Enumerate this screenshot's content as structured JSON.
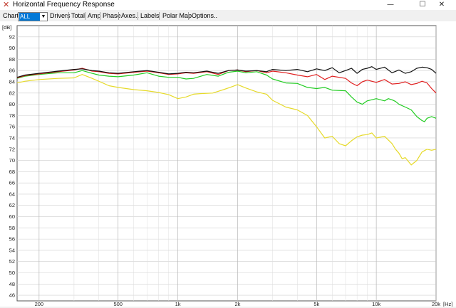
{
  "window": {
    "title": "Horizontal Frequency Response",
    "app_icon": "x-cross-icon",
    "minimize_glyph": "—",
    "maximize_glyph": "☐",
    "close_glyph": "✕"
  },
  "toolbar": {
    "chart_label": "Chart",
    "chart_value": "ALL",
    "buttons": [
      "Drivers",
      "Total",
      "Amp",
      "Phase",
      "Axes..",
      "Labels",
      "Polar Map",
      "Options.."
    ]
  },
  "chart_data": {
    "type": "line",
    "ylabel": "[dB]",
    "xlabel": "[Hz]",
    "xscale": "log",
    "xlim": [
      155,
      20000
    ],
    "ylim": [
      45,
      94
    ],
    "yticks": [
      46,
      48,
      50,
      52,
      54,
      56,
      58,
      60,
      62,
      64,
      66,
      68,
      70,
      72,
      74,
      76,
      78,
      80,
      82,
      84,
      86,
      88,
      90,
      92
    ],
    "xticks": [
      {
        "value": 200,
        "label": "200"
      },
      {
        "value": 500,
        "label": "500"
      },
      {
        "value": 1000,
        "label": "1k"
      },
      {
        "value": 2000,
        "label": "2k"
      },
      {
        "value": 5000,
        "label": "5k"
      },
      {
        "value": 10000,
        "label": "10k"
      },
      {
        "value": 20000,
        "label": "20k"
      }
    ],
    "grid": true,
    "series": [
      {
        "color": "#e6da2a",
        "x": [
          155,
          170,
          200,
          250,
          300,
          330,
          370,
          400,
          450,
          500,
          600,
          700,
          800,
          900,
          1000,
          1100,
          1200,
          1300,
          1500,
          1700,
          1900,
          2000,
          2200,
          2500,
          2800,
          3000,
          3500,
          4000,
          4500,
          5000,
          5500,
          6000,
          6500,
          7000,
          7500,
          8000,
          8500,
          9000,
          9500,
          10000,
          11000,
          12000,
          12500,
          13000,
          13500,
          14000,
          15000,
          16000,
          17000,
          18000,
          19000,
          20000
        ],
        "y": [
          83.8,
          84.1,
          84.4,
          84.6,
          84.7,
          85.3,
          84.6,
          84.1,
          83.3,
          83.0,
          82.6,
          82.4,
          82.1,
          81.7,
          81.0,
          81.3,
          81.8,
          81.9,
          82.0,
          82.6,
          83.2,
          83.5,
          82.9,
          82.2,
          81.8,
          80.7,
          79.5,
          79.0,
          78.0,
          76.0,
          74.0,
          74.3,
          73.0,
          72.6,
          73.5,
          74.2,
          74.5,
          74.6,
          74.9,
          74.0,
          74.3,
          73.0,
          72.0,
          71.3,
          70.3,
          70.5,
          69.2,
          70.0,
          71.5,
          72.0,
          71.8,
          72.0
        ]
      },
      {
        "color": "#22cc22",
        "x": [
          155,
          170,
          200,
          250,
          300,
          330,
          370,
          400,
          450,
          500,
          600,
          700,
          800,
          900,
          1000,
          1100,
          1200,
          1400,
          1600,
          1800,
          2000,
          2200,
          2500,
          2800,
          3000,
          3500,
          4000,
          4500,
          5000,
          5500,
          6000,
          7000,
          7500,
          8000,
          8500,
          9000,
          10000,
          11000,
          11500,
          12000,
          12500,
          13000,
          14000,
          15000,
          16000,
          17000,
          17500,
          18000,
          19000,
          20000
        ],
        "y": [
          84.6,
          85.0,
          85.3,
          85.6,
          85.6,
          86.0,
          85.5,
          85.2,
          85.0,
          84.9,
          85.2,
          85.6,
          85.0,
          84.8,
          84.8,
          84.5,
          84.6,
          85.3,
          85.0,
          85.7,
          85.9,
          85.6,
          85.8,
          85.2,
          84.5,
          83.8,
          83.7,
          83.0,
          82.8,
          83.0,
          82.5,
          82.4,
          81.3,
          80.4,
          80.0,
          80.6,
          81.0,
          80.6,
          81.0,
          80.8,
          80.5,
          80.0,
          79.5,
          79.0,
          77.8,
          77.1,
          76.9,
          77.5,
          77.8,
          77.5
        ]
      },
      {
        "color": "#e02020",
        "x": [
          155,
          170,
          200,
          250,
          300,
          330,
          370,
          400,
          450,
          500,
          600,
          700,
          800,
          900,
          1000,
          1100,
          1200,
          1400,
          1600,
          1800,
          2000,
          2200,
          2500,
          2800,
          3000,
          3500,
          4000,
          4500,
          5000,
          5500,
          6000,
          7000,
          7500,
          8000,
          8500,
          9000,
          10000,
          11000,
          12000,
          13000,
          14000,
          15000,
          16000,
          17000,
          18000,
          19000,
          20000
        ],
        "y": [
          84.7,
          85.1,
          85.4,
          85.8,
          86.1,
          86.4,
          85.9,
          85.8,
          85.5,
          85.4,
          85.7,
          85.9,
          85.6,
          85.3,
          85.4,
          85.6,
          85.5,
          85.8,
          85.3,
          86.0,
          86.1,
          85.8,
          86.0,
          85.6,
          85.9,
          85.6,
          85.2,
          84.9,
          85.3,
          84.4,
          85.0,
          84.6,
          83.8,
          83.3,
          84.0,
          84.3,
          83.9,
          84.4,
          83.6,
          83.7,
          84.0,
          83.5,
          83.7,
          84.1,
          83.8,
          82.8,
          82.0
        ]
      },
      {
        "color": "#111111",
        "x": [
          155,
          170,
          200,
          250,
          300,
          330,
          370,
          400,
          450,
          500,
          600,
          700,
          800,
          900,
          1000,
          1100,
          1200,
          1400,
          1600,
          1800,
          2000,
          2200,
          2500,
          2800,
          3000,
          3500,
          4000,
          4500,
          5000,
          5500,
          6000,
          6500,
          7000,
          7500,
          8000,
          8500,
          9000,
          9500,
          10000,
          11000,
          12000,
          13000,
          14000,
          15000,
          16000,
          17000,
          18000,
          19000,
          20000
        ],
        "y": [
          84.8,
          85.2,
          85.5,
          85.9,
          86.2,
          86.3,
          86.0,
          85.9,
          85.6,
          85.5,
          85.8,
          86.0,
          85.7,
          85.4,
          85.5,
          85.7,
          85.6,
          85.9,
          85.5,
          86.0,
          86.1,
          85.9,
          86.0,
          85.8,
          86.2,
          86.0,
          86.2,
          85.8,
          86.3,
          86.0,
          86.5,
          85.6,
          86.0,
          86.4,
          85.5,
          86.2,
          86.4,
          86.7,
          86.2,
          86.6,
          85.6,
          86.1,
          85.5,
          85.8,
          86.4,
          86.6,
          86.5,
          86.2,
          85.5
        ]
      }
    ]
  }
}
